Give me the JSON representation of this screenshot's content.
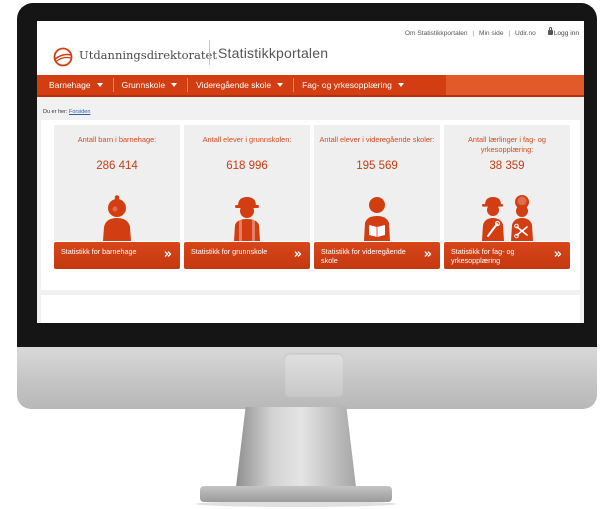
{
  "header": {
    "brand_name": "Utdanningsdirektoratet",
    "portal_name": "Statistikkportalen",
    "top_links": [
      "Om Statistikkportalen",
      "Min side",
      "Udir.no"
    ],
    "login_label": "Logg inn"
  },
  "nav": {
    "items": [
      {
        "label": "Barnehage"
      },
      {
        "label": "Grunnskole"
      },
      {
        "label": "Videregående skole"
      },
      {
        "label": "Fag- og yrkesopplæring"
      }
    ]
  },
  "breadcrumb": {
    "prefix": "Du er her:",
    "current": "Forsiden"
  },
  "cards": [
    {
      "label": "Antall barn i barnehage:",
      "value": "286 414",
      "button": "Statistikk for barnehage",
      "icon": "child-icon"
    },
    {
      "label": "Antall elever i grunnskolen:",
      "value": "618 996",
      "button": "Statistikk for grunnskole",
      "icon": "pupil-cap-icon"
    },
    {
      "label": "Antall elever i videregående skoler:",
      "value": "195 569",
      "button": "Statistikk for videregående skole",
      "icon": "student-book-icon"
    },
    {
      "label": "Antall lærlinger i fag- og yrkesopplæring:",
      "value": "38 359",
      "button": "Statistikk for fag- og yrkesopplæring",
      "icon": "apprentices-tools-icon"
    }
  ],
  "button_arrow": "»",
  "colors": {
    "accent": "#d33d12",
    "accent_text": "#d54a1f",
    "card_bg": "#efefef"
  }
}
